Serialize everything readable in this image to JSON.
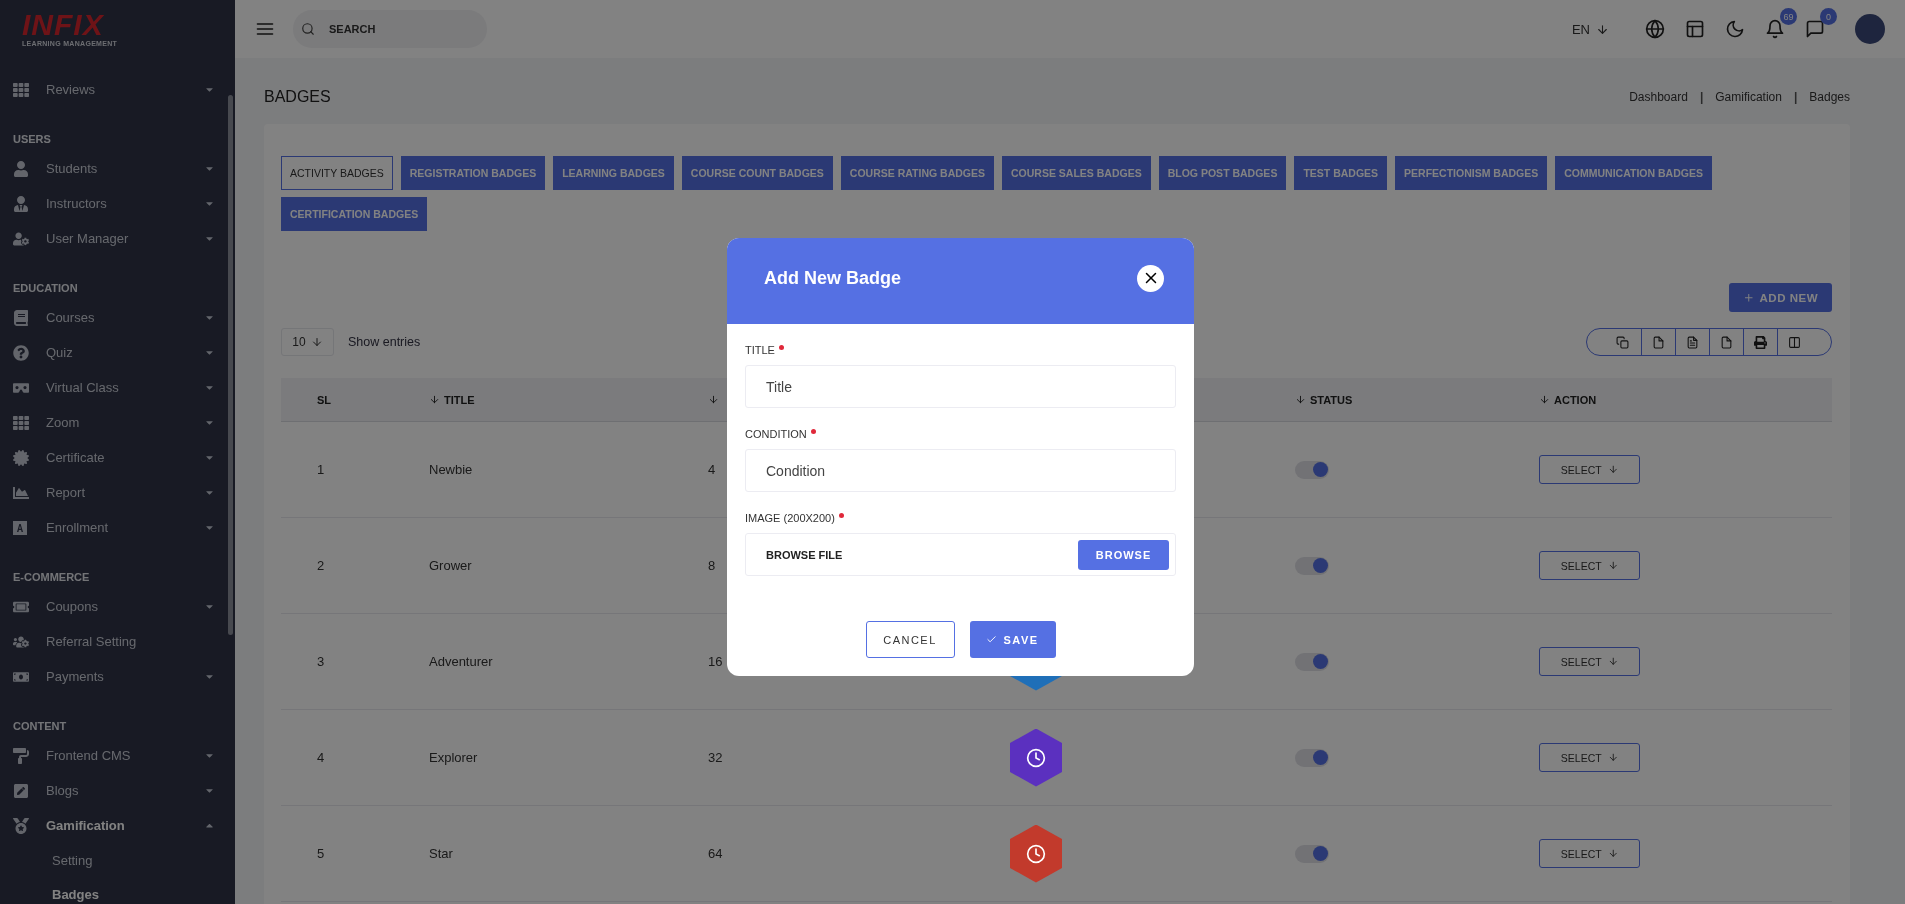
{
  "sidebar": {
    "logo": {
      "brand": "INFIX",
      "tagline": "LEARNING MANAGEMENT"
    },
    "sections": [
      {
        "items": [
          {
            "label": "Reviews",
            "kind": "group",
            "expanded": false
          }
        ]
      },
      {
        "heading": "USERS",
        "items": [
          {
            "label": "Students",
            "kind": "group",
            "expanded": false
          },
          {
            "label": "Instructors",
            "kind": "group",
            "expanded": false
          },
          {
            "label": "User Manager",
            "kind": "group",
            "expanded": false
          }
        ]
      },
      {
        "heading": "EDUCATION",
        "items": [
          {
            "label": "Courses",
            "kind": "group",
            "expanded": false
          },
          {
            "label": "Quiz",
            "kind": "group",
            "expanded": false
          },
          {
            "label": "Virtual Class",
            "kind": "group",
            "expanded": false
          },
          {
            "label": "Zoom",
            "kind": "group",
            "expanded": false
          },
          {
            "label": "Certificate",
            "kind": "group",
            "expanded": false
          },
          {
            "label": "Report",
            "kind": "group",
            "expanded": false
          },
          {
            "label": "Enrollment",
            "kind": "group",
            "expanded": false
          }
        ]
      },
      {
        "heading": "E-COMMERCE",
        "items": [
          {
            "label": "Coupons",
            "kind": "group",
            "expanded": false
          },
          {
            "label": "Referral Setting",
            "kind": "link"
          },
          {
            "label": "Payments",
            "kind": "group",
            "expanded": false
          }
        ]
      },
      {
        "heading": "CONTENT",
        "items": [
          {
            "label": "Frontend CMS",
            "kind": "group",
            "expanded": false
          },
          {
            "label": "Blogs",
            "kind": "group",
            "expanded": false
          },
          {
            "label": "Gamification",
            "kind": "group",
            "expanded": true,
            "children": [
              {
                "label": "Setting",
                "selected": false
              },
              {
                "label": "Badges",
                "selected": true
              }
            ]
          }
        ]
      }
    ]
  },
  "topbar": {
    "search": {
      "placeholder": "SEARCH"
    },
    "language": "EN",
    "notifications": "69",
    "messages": "0"
  },
  "page": {
    "title": "BADGES",
    "breadcrumb": [
      {
        "kind": "link",
        "text": "Dashboard"
      },
      {
        "kind": "separator",
        "text": "|"
      },
      {
        "kind": "link",
        "text": "Gamification"
      },
      {
        "kind": "separator",
        "text": "|"
      },
      {
        "kind": "link",
        "text": "Badges"
      }
    ]
  },
  "tabs": [
    {
      "label": "ACTIVITY BADGES",
      "selected": true
    },
    {
      "label": "REGISTRATION BADGES",
      "selected": false
    },
    {
      "label": "LEARNING BADGES",
      "selected": false
    },
    {
      "label": "COURSE COUNT BADGES",
      "selected": false
    },
    {
      "label": "COURSE RATING BADGES",
      "selected": false
    },
    {
      "label": "COURSE SALES BADGES",
      "selected": false
    },
    {
      "label": "BLOG POST BADGES",
      "selected": false
    },
    {
      "label": "TEST BADGES",
      "selected": false
    },
    {
      "label": "PERFECTIONISM BADGES",
      "selected": false
    },
    {
      "label": "COMMUNICATION BADGES",
      "selected": false
    },
    {
      "label": "CERTIFICATION BADGES",
      "selected": false
    }
  ],
  "add_new": "ADD NEW",
  "entries": {
    "value": "10",
    "label": "Show entries"
  },
  "table": {
    "columns": [
      {
        "label": "SL",
        "sortable": false
      },
      {
        "label": "TITLE",
        "sortable": true
      },
      {
        "sortable": true
      },
      {
        "label": "STATUS",
        "sortable": true
      },
      {
        "label": "ACTION",
        "sortable": true
      }
    ],
    "rows": [
      {
        "sl": "1",
        "title": "Newbie",
        "column_3": "4",
        "status_on": true,
        "action": "SELECT"
      },
      {
        "sl": "2",
        "title": "Grower",
        "column_3": "8",
        "status_on": true,
        "action": "SELECT"
      },
      {
        "sl": "3",
        "title": "Adventurer",
        "column_3": "16",
        "color": "#1f6fb8",
        "status_on": true,
        "action": "SELECT"
      },
      {
        "sl": "4",
        "title": "Explorer",
        "column_3": "32",
        "color": "#5b30bf",
        "status_on": true,
        "action": "SELECT"
      },
      {
        "sl": "5",
        "title": "Star",
        "column_3": "64",
        "color": "#c23a2c",
        "status_on": true,
        "action": "SELECT"
      }
    ]
  },
  "modal": {
    "title": "Add New Badge",
    "fields": [
      {
        "kind": "text",
        "label": "TITLE",
        "required": true,
        "placeholder": "Title"
      },
      {
        "kind": "text",
        "label": "CONDITION",
        "required": true,
        "placeholder": "Condition"
      },
      {
        "kind": "file",
        "label": "IMAGE (200X200)",
        "required": true,
        "value": "BROWSE FILE",
        "button": "BROWSE"
      }
    ],
    "cancel": "CANCEL",
    "save": "SAVE"
  }
}
